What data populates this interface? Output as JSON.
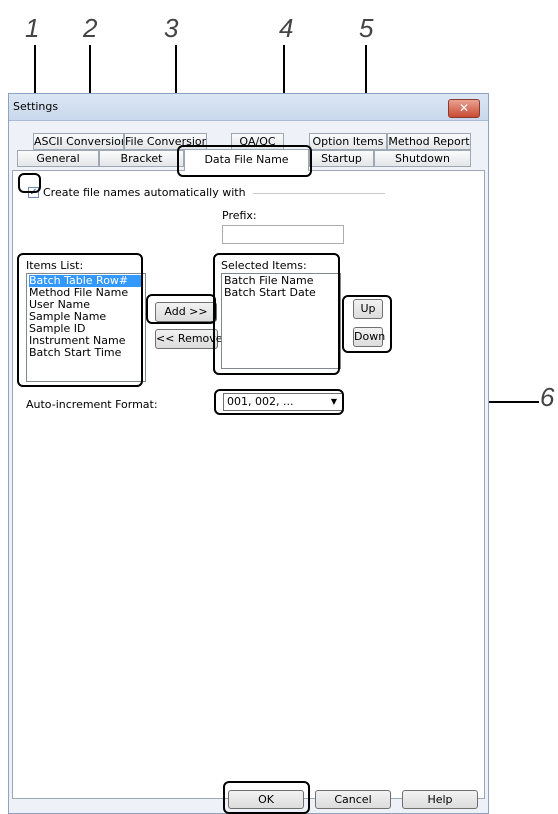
{
  "callouts": [
    "1",
    "2",
    "3",
    "4",
    "5",
    "6"
  ],
  "window": {
    "title": "Settings",
    "close_glyph": "✕"
  },
  "tabs_back": [
    "ASCII Conversion",
    "File Conversion",
    "QA/QC",
    "Option Items",
    "Method Report"
  ],
  "tabs_front": [
    "General",
    "Bracket",
    "Data File Name",
    "Startup",
    "Shutdown"
  ],
  "auto_name": {
    "label": "Create file names automatically with",
    "checked": true,
    "check_glyph": "✓"
  },
  "prefix": {
    "label": "Prefix:",
    "value": ""
  },
  "items_list": {
    "label": "Items List:",
    "items": [
      "Batch Table Row#",
      "Method File Name",
      "User Name",
      "Sample Name",
      "Sample ID",
      "Instrument Name",
      "Batch Start Time"
    ],
    "selected_index": 0
  },
  "selected_items": {
    "label": "Selected Items:",
    "items": [
      "Batch File Name",
      "Batch Start Date"
    ]
  },
  "buttons": {
    "add": "Add >>",
    "remove": "<< Remove",
    "up": "Up",
    "down": "Down",
    "ok": "OK",
    "cancel": "Cancel",
    "help": "Help"
  },
  "auto_increment": {
    "label": "Auto-increment Format:",
    "value": "001, 002, ..."
  }
}
